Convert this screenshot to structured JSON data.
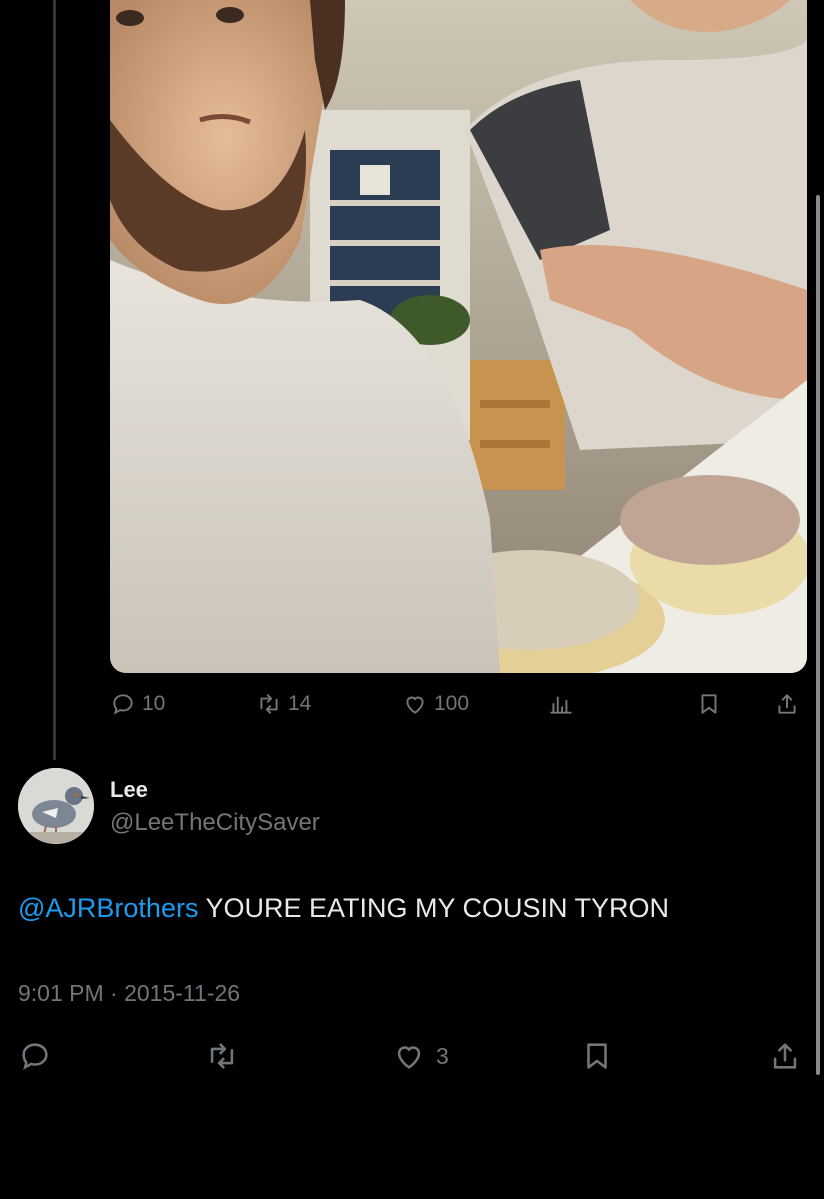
{
  "tweet_top": {
    "photo_icon": "photo",
    "reply_count": "10",
    "retweet_count": "14",
    "like_count": "100",
    "icons": {
      "reply": "reply-icon",
      "retweet": "retweet-icon",
      "like": "heart-icon",
      "views": "views-icon",
      "bookmark": "bookmark-icon",
      "share": "share-icon"
    }
  },
  "reply": {
    "display_name": "Lee",
    "handle": "@LeeTheCitySaver",
    "mention": "@AJRBrothers",
    "text": " YOURE EATING MY COUSIN TYRON",
    "timestamp": "9:01 PM · 2015-11-26",
    "like_count": "3"
  },
  "colors": {
    "background": "#000000",
    "text": "#e7e9ea",
    "secondary": "#71767b",
    "link": "#1d9bf0"
  }
}
